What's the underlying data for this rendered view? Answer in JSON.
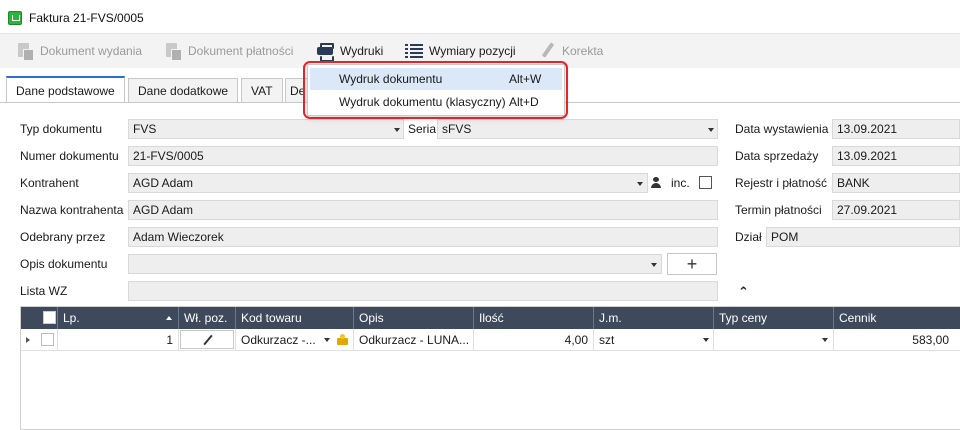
{
  "window": {
    "title": "Faktura 21-FVS/0005",
    "app_icon": "basket-icon"
  },
  "toolbar": {
    "buttons": [
      {
        "label": "Dokument wydania",
        "icon": "document-icon",
        "enabled": false
      },
      {
        "label": "Dokument płatności",
        "icon": "document-payment-icon",
        "enabled": false
      },
      {
        "label": "Wydruki",
        "icon": "printer-icon",
        "enabled": true
      },
      {
        "label": "Wymiary pozycji",
        "icon": "list-icon",
        "enabled": true
      },
      {
        "label": "Korekta",
        "icon": "pencil-icon",
        "enabled": false
      }
    ]
  },
  "tabs": [
    {
      "label": "Dane podstawowe",
      "active": true
    },
    {
      "label": "Dane dodatkowe"
    },
    {
      "label": "VAT"
    },
    {
      "label": "De"
    }
  ],
  "print_menu": {
    "items": [
      {
        "label": "Wydruk dokumentu",
        "shortcut": "Alt+W",
        "highlighted": true
      },
      {
        "label": "Wydruk dokumentu (klasyczny)",
        "shortcut": "Alt+D"
      }
    ],
    "highlight_color": "#e0262b"
  },
  "form": {
    "typ_label": "Typ dokumentu",
    "typ_value": "FVS",
    "seria_label": "Seria",
    "seria_value": "sFVS",
    "numer_label": "Numer dokumentu",
    "numer_value": "21-FVS/0005",
    "kontrahent_label": "Kontrahent",
    "kontrahent_value": "AGD Adam",
    "inc_label": "inc.",
    "nazwa_label": "Nazwa kontrahenta",
    "nazwa_value": "AGD Adam",
    "odebrany_label": "Odebrany przez",
    "odebrany_value": "Adam Wieczorek",
    "opis_label": "Opis dokumentu",
    "opis_value": "",
    "plus_label": "+",
    "lista_label": "Lista WZ",
    "lista_value": ""
  },
  "right_form": {
    "data_wyst_label": "Data wystawienia",
    "data_wyst_value": "13.09.2021",
    "data_sprz_label": "Data sprzedaży",
    "data_sprz_value": "13.09.2021",
    "rejestr_label": "Rejestr i płatność",
    "rejestr_value": "BANK",
    "termin_label": "Termin płatności",
    "termin_value": "27.09.2021",
    "dzial_label": "Dział",
    "dzial_value": "POM"
  },
  "grid": {
    "headers": [
      "Lp.",
      "Wł. poz.",
      "Kod towaru",
      "Opis",
      "Ilość",
      "J.m.",
      "Typ ceny",
      "Cennik"
    ],
    "rows": [
      {
        "lp": "1",
        "kod": "Odkurzacz -...",
        "opis": "Odkurzacz - LUNA...",
        "ilosc": "4,00",
        "jm": "szt",
        "typ_ceny": "",
        "cennik": "583,00"
      }
    ]
  },
  "colors": {
    "grid_header": "#3e4a5c",
    "menu_highlight": "#dbe8f7",
    "tab_accent": "#2a6fcf"
  }
}
